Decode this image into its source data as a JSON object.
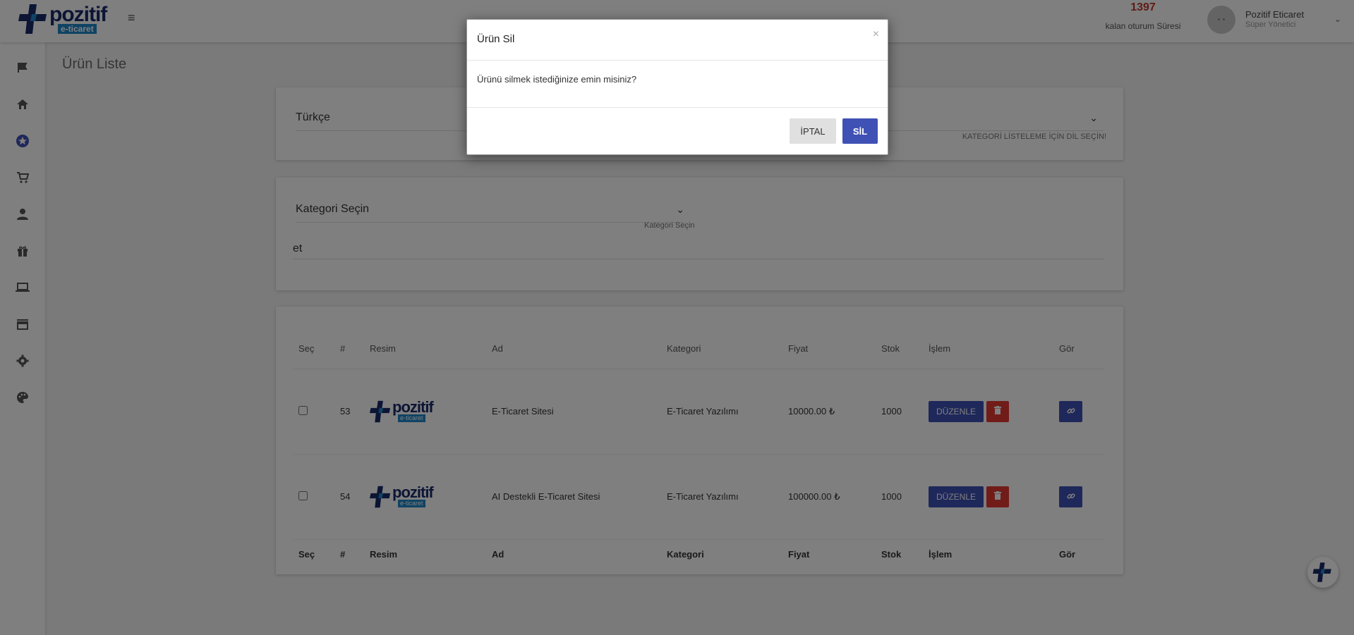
{
  "brand": {
    "name": "pozitif",
    "tagline": "e-ticaret"
  },
  "session": {
    "remaining": "1397",
    "label": "kalan oturum Süresi"
  },
  "user": {
    "avatar_text": "• •",
    "name": "Pozitif Eticaret",
    "role": "Süper Yönetici"
  },
  "sidebar": {
    "items": [
      {
        "icon": "flag-icon"
      },
      {
        "icon": "home-icon"
      },
      {
        "icon": "star-icon"
      },
      {
        "icon": "cart-icon"
      },
      {
        "icon": "person-icon"
      },
      {
        "icon": "gift-icon"
      },
      {
        "icon": "laptop-icon"
      },
      {
        "icon": "store-icon"
      },
      {
        "icon": "gear-icon"
      },
      {
        "icon": "palette-icon"
      }
    ]
  },
  "page": {
    "title": "Ürün Liste"
  },
  "language_filter": {
    "selected": "Türkçe",
    "hint": "KATEGORİ LİSTELEME İÇİN DİL SEÇİN!"
  },
  "category_filter": {
    "selected": "Kategori Seçin",
    "hint": "Kategori Seçin"
  },
  "search": {
    "value": "et"
  },
  "table": {
    "headers": [
      "Seç",
      "#",
      "Resim",
      "Ad",
      "Kategori",
      "Fiyat",
      "Stok",
      "İşlem",
      "Gör"
    ],
    "rows": [
      {
        "id": "53",
        "name": "E-Ticaret Sitesi",
        "category": "E-Ticaret Yazılımı",
        "price": "10000.00 ₺",
        "stock": "1000"
      },
      {
        "id": "54",
        "name": "AI Destekli E-Ticaret Sitesi",
        "category": "E-Ticaret Yazılımı",
        "price": "100000.00 ₺",
        "stock": "1000"
      }
    ],
    "edit_label": "DÜZENLE"
  },
  "modal": {
    "title": "Ürün Sil",
    "message": "Ürünü silmek istediğinize emin misiniz?",
    "cancel_label": "İPTAL",
    "confirm_label": "SİL",
    "close_symbol": "×"
  },
  "colors": {
    "primary": "#3f51b5",
    "danger": "#e53935",
    "timer": "#c0392b",
    "brand_blue": "#1b2a6b",
    "tagline_bg": "#1f86c8"
  }
}
